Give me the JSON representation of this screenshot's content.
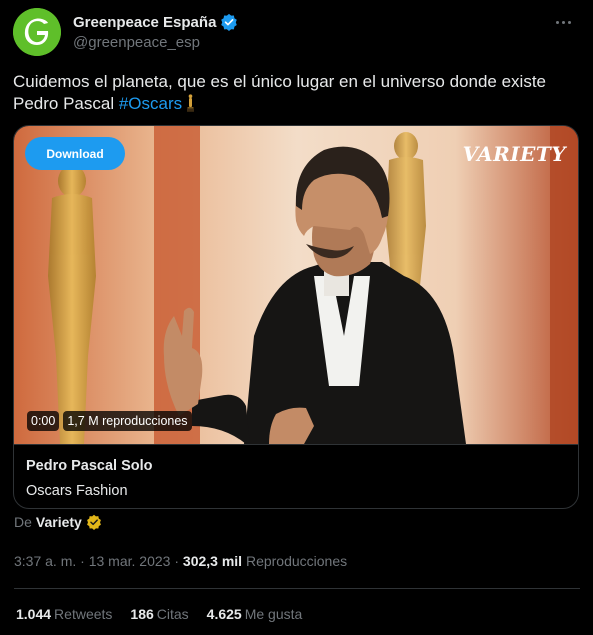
{
  "author": {
    "display_name": "Greenpeace España",
    "handle": "@greenpeace_esp"
  },
  "tweet": {
    "text_main": "Cuidemos el planeta, que es el único lugar en el universo donde existe Pedro Pascal ",
    "hashtag": "#Oscars"
  },
  "card": {
    "download_label": "Download",
    "brand_mark": "VARIETY",
    "video_time": "0:00",
    "video_views": "1,7 M reproducciones",
    "title": "Pedro Pascal Solo",
    "subtitle": "Oscars Fashion"
  },
  "source": {
    "prefix": "De",
    "name": "Variety"
  },
  "meta": {
    "time": "3:37 a. m.",
    "sep1": "·",
    "date": "13 mar. 2023",
    "sep2": "·",
    "views_count": "302,3 mil",
    "views_label": "Reproducciones"
  },
  "stats": {
    "retweets_count": "1.044",
    "retweets_label": "Retweets",
    "quotes_count": "186",
    "quotes_label": "Citas",
    "likes_count": "4.625",
    "likes_label": "Me gusta"
  },
  "colors": {
    "background": "#000000",
    "accent": "#1d9bf0",
    "muted": "#71767b",
    "border": "#2f3336",
    "avatar_green": "#5fbf2a",
    "gold_badge": "#e2b719"
  },
  "icons": {
    "verified": "verified-badge-icon",
    "more": "more-options-icon",
    "business_badge": "gold-business-badge-icon",
    "statue_emoji": "oscar-statue-emoji"
  }
}
